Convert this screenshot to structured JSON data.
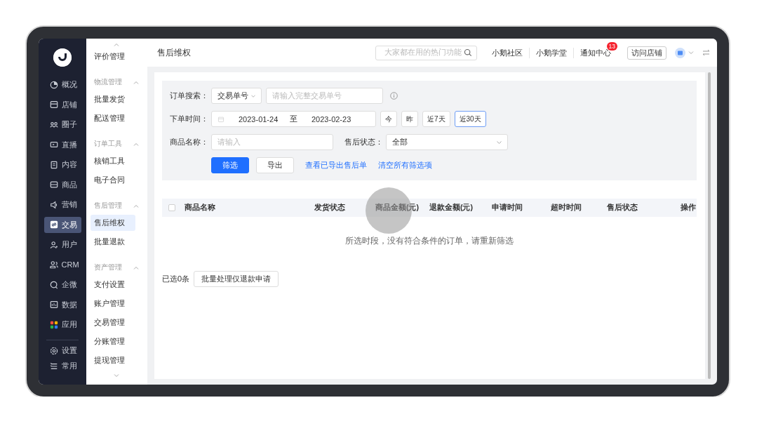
{
  "nav": {
    "items": [
      {
        "label": "概况",
        "selected": false
      },
      {
        "label": "店铺",
        "selected": false
      },
      {
        "label": "圈子",
        "selected": false
      },
      {
        "label": "直播",
        "selected": false
      },
      {
        "label": "内容",
        "selected": false
      },
      {
        "label": "商品",
        "selected": false
      },
      {
        "label": "营销",
        "selected": false
      },
      {
        "label": "交易",
        "selected": true
      },
      {
        "label": "用户",
        "selected": false
      },
      {
        "label": "CRM",
        "selected": false
      },
      {
        "label": "企微",
        "selected": false
      },
      {
        "label": "数据",
        "selected": false
      },
      {
        "label": "应用",
        "selected": false
      }
    ],
    "bottom_items": [
      {
        "label": "设置"
      },
      {
        "label": "常用"
      }
    ]
  },
  "submenu": {
    "top_item": "评价管理",
    "groups": [
      {
        "title": "物流管理",
        "expanded": true,
        "items": [
          {
            "label": "批量发货",
            "selected": false
          },
          {
            "label": "配送管理",
            "selected": false
          }
        ]
      },
      {
        "title": "订单工具",
        "expanded": true,
        "items": [
          {
            "label": "核销工具",
            "selected": false
          },
          {
            "label": "电子合同",
            "selected": false
          }
        ]
      },
      {
        "title": "售后管理",
        "expanded": true,
        "items": [
          {
            "label": "售后维权",
            "selected": true
          },
          {
            "label": "批量退款",
            "selected": false
          }
        ]
      },
      {
        "title": "资产管理",
        "expanded": true,
        "items": [
          {
            "label": "支付设置",
            "selected": false
          },
          {
            "label": "账户管理",
            "selected": false
          },
          {
            "label": "交易管理",
            "selected": false
          },
          {
            "label": "分账管理",
            "selected": false
          },
          {
            "label": "提现管理",
            "selected": false
          }
        ]
      }
    ]
  },
  "header": {
    "title": "售后维权",
    "search": {
      "placeholder": "大家都在用的热门功能"
    },
    "links": [
      {
        "label": "小鹅社区"
      },
      {
        "label": "小鹅学堂"
      },
      {
        "label": "通知中心",
        "badge": "13"
      }
    ],
    "visit_button": "访问店铺"
  },
  "filters": {
    "order_search": {
      "label": "订单搜索：",
      "type": "交易单号",
      "placeholder": "请输入完整交易单号"
    },
    "order_time": {
      "label": "下单时间：",
      "start": "2023-01-24",
      "separator": "至",
      "end": "2023-02-23",
      "quick": [
        {
          "label": "今",
          "selected": false
        },
        {
          "label": "昨",
          "selected": false
        },
        {
          "label": "近7天",
          "selected": false
        },
        {
          "label": "近30天",
          "selected": true
        }
      ]
    },
    "product_name": {
      "label": "商品名称：",
      "placeholder": "请输入"
    },
    "status": {
      "label": "售后状态：",
      "value": "全部"
    },
    "actions": {
      "filter": "筛选",
      "export": "导出",
      "links": [
        "查看已导出售后单",
        "清空所有筛选项"
      ]
    }
  },
  "table": {
    "select_all_checked": false,
    "columns": [
      "商品名称",
      "发货状态",
      "商品金额(元)",
      "退款金额(元)",
      "申请时间",
      "超时时间",
      "售后状态",
      "操作"
    ],
    "empty_message": "所选时段，没有符合条件的订单，请重新筛选"
  },
  "footer": {
    "selected_count": "已选0条",
    "batch_button": "批量处理仅退款申请"
  }
}
